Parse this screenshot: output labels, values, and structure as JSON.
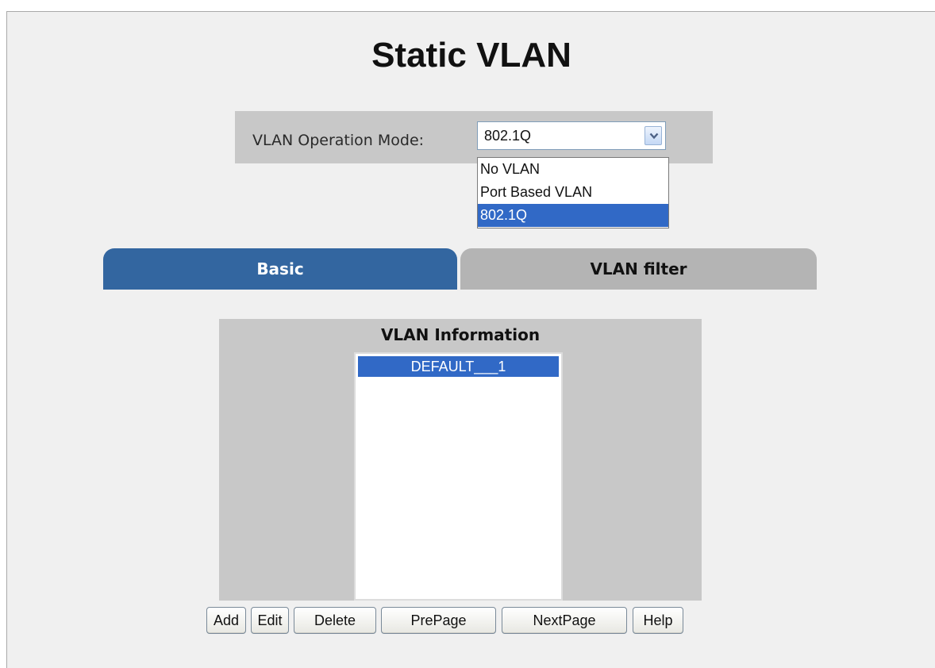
{
  "page": {
    "title": "Static VLAN"
  },
  "mode": {
    "label": "VLAN Operation Mode:",
    "selected": "802.1Q",
    "options": [
      "No VLAN",
      "Port Based VLAN",
      "802.1Q"
    ],
    "highlighted_option": "802.1Q"
  },
  "tabs": [
    {
      "label": "Basic",
      "active": true
    },
    {
      "label": "VLAN filter",
      "active": false
    }
  ],
  "vlan_info": {
    "title": "VLAN Information",
    "items": [
      "DEFAULT___1"
    ],
    "selected_item": "DEFAULT___1"
  },
  "buttons": {
    "add": "Add",
    "edit": "Edit",
    "delete": "Delete",
    "prepage": "PrePage",
    "nextpage": "NextPage",
    "help": "Help"
  },
  "colors": {
    "active_tab": "#3366a0",
    "inactive_tab": "#b4b4b4",
    "selection_highlight": "#3169c6",
    "panel_background": "#c8c8c8"
  },
  "icons": {
    "dropdown_arrow": "chevron-down-icon"
  }
}
